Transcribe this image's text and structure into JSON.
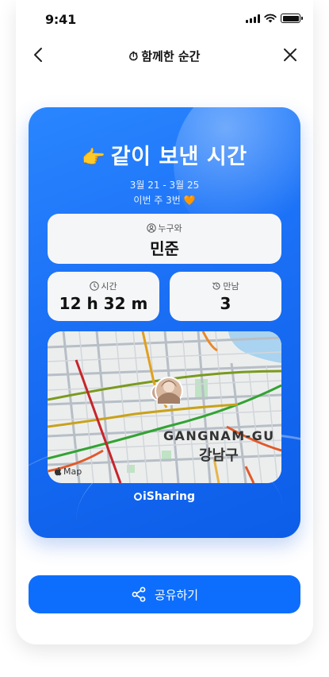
{
  "status_bar": {
    "time": "9:41"
  },
  "nav": {
    "title_icon": "⏱",
    "title": "함께한 순간"
  },
  "card": {
    "title_emoji": "👉",
    "title": "같이 보낸 시간",
    "date_range": "3월 21 - 3월 25",
    "week_count": "이번 주 3번 🧡",
    "who": {
      "label": "누구와",
      "value": "민준"
    },
    "time": {
      "label": "시간",
      "value": "12 h 32 m"
    },
    "meetings": {
      "label": "만남",
      "value": "3"
    },
    "map": {
      "district_en": "GANGNAM-GU",
      "district_ko": "강남구",
      "attribution": "Map"
    },
    "brand": "iSharing"
  },
  "share_button": {
    "label": "공유하기"
  },
  "colors": {
    "card_blue": "#1a6ff5",
    "button_blue": "#0d6efd",
    "tile_bg": "#f5f6f8"
  }
}
